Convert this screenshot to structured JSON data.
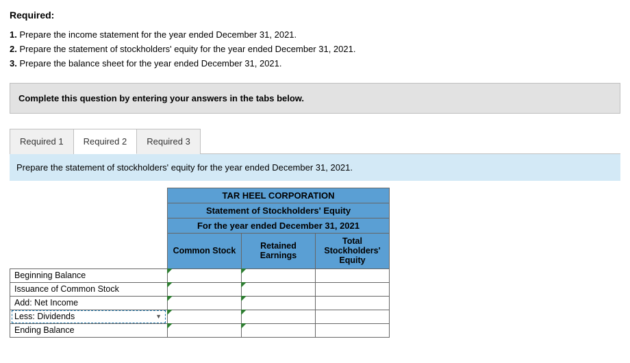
{
  "header": {
    "required_label": "Required:"
  },
  "requirements": [
    {
      "num": "1.",
      "text": "Prepare the income statement for the year ended December 31, 2021."
    },
    {
      "num": "2.",
      "text": "Prepare the statement of stockholders' equity for the year ended December 31, 2021."
    },
    {
      "num": "3.",
      "text": "Prepare the balance sheet for the year ended December 31, 2021."
    }
  ],
  "instruction": "Complete this question by entering your answers in the tabs below.",
  "tabs": {
    "items": [
      {
        "label": "Required 1",
        "active": false
      },
      {
        "label": "Required 2",
        "active": true
      },
      {
        "label": "Required 3",
        "active": false
      }
    ],
    "panel_text": "Prepare the statement of stockholders' equity for the year ended December 31, 2021."
  },
  "worksheet": {
    "title_line1": "TAR HEEL CORPORATION",
    "title_line2": "Statement of Stockholders' Equity",
    "title_line3": "For the year ended December 31, 2021",
    "col_headers": [
      "Common Stock",
      "Retained Earnings",
      "Total Stockholders' Equity"
    ],
    "rows": [
      {
        "label": "Beginning Balance",
        "dotted": false,
        "arrow": false
      },
      {
        "label": "Issuance of Common Stock",
        "dotted": false,
        "arrow": false
      },
      {
        "label": "Add: Net Income",
        "dotted": false,
        "arrow": false
      },
      {
        "label": "Less: Dividends",
        "dotted": true,
        "arrow": true
      },
      {
        "label": "Ending Balance",
        "dotted": false,
        "arrow": false
      }
    ]
  }
}
